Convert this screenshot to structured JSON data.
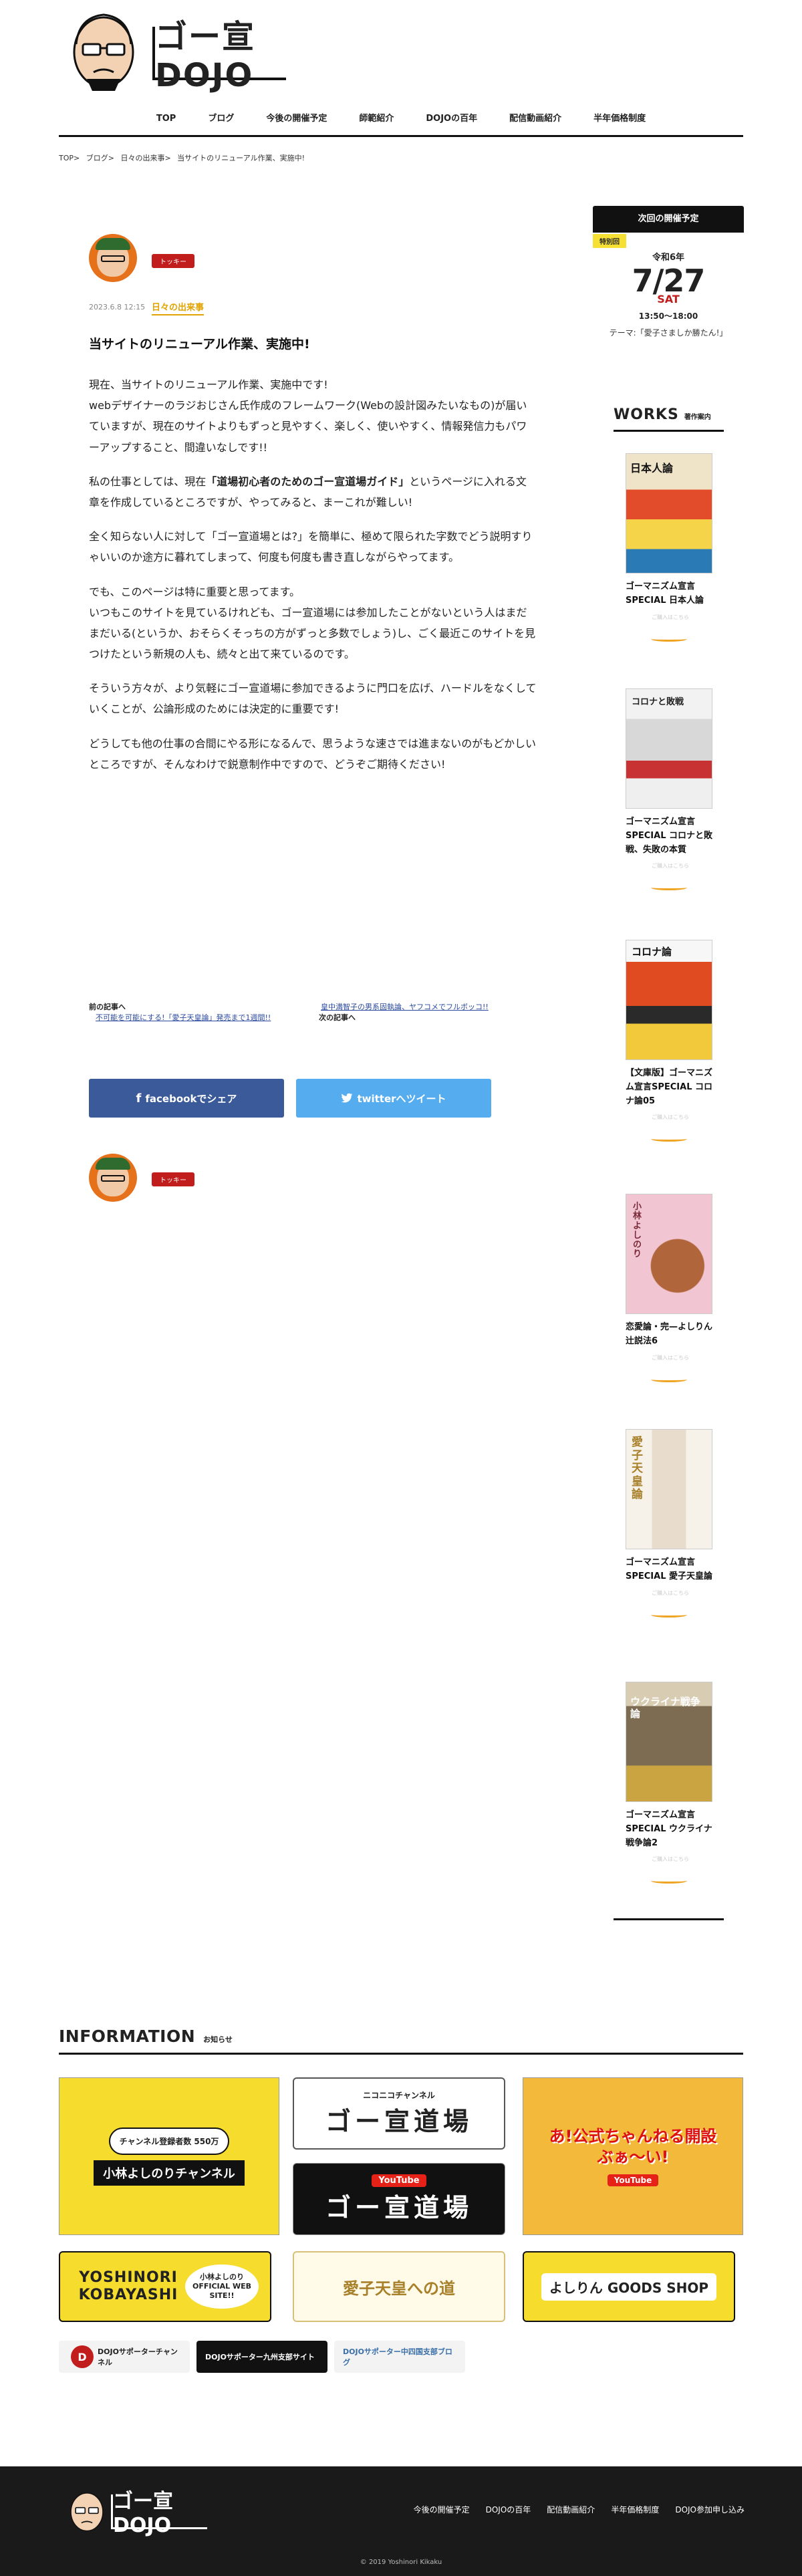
{
  "header": {
    "logo_text": "ゴー宣DOJO",
    "nav": [
      "TOP",
      "ブログ",
      "今後の開催予定",
      "師範紹介",
      "DOJOの百年",
      "配信動画紹介",
      "半年価格制度"
    ]
  },
  "breadcrumb": [
    "TOP",
    ">",
    "ブログ",
    ">",
    "日々の出来事",
    ">",
    "当サイトのリニューアル作業、実施中!"
  ],
  "post": {
    "author_tag": "トッキー",
    "date": "2023.6.8 12:15",
    "category": "日々の出来事",
    "title": "当サイトのリニューアル作業、実施中!",
    "p1": "現在、当サイトのリニューアル作業、実施中です!",
    "p1b": "webデザイナーのラジおじさん氏作成のフレームワーク(Webの設計図みたいなもの)が届いていますが、現在のサイトよりもずっと見やすく、楽しく、使いやすく、情報発信力もパワーアップすること、間違いなしです!!",
    "p2a": "私の仕事としては、現在",
    "p2b": "「道場初心者のためのゴー宣道場ガイド」",
    "p2c": "というページに入れる文章を作成しているところですが、やってみると、まーこれが難しい!",
    "p3": "全く知らない人に対して「ゴー宣道場とは?」を簡単に、極めて限られた字数でどう説明すりゃいいのか途方に暮れてしまって、何度も何度も書き直しながらやってます。",
    "p4": "でも、このページは特に重要と思ってます。",
    "p4b": "いつもこのサイトを見ているけれども、ゴー宣道場には参加したことがないという人はまだまだいる(というか、おそらくそっちの方がずっと多数でしょう)し、ごく最近このサイトを見つけたという新規の人も、続々と出て来ているのです。",
    "p5": "そういう方々が、より気軽にゴー宣道場に参加できるように門口を広げ、ハードルをなくしていくことが、公論形成のためには決定的に重要です!",
    "p6": "どうしても他の仕事の合間にやる形になるんで、思うような速さでは進まないのがもどかしいところですが、そんなわけで鋭意制作中ですので、どうぞご期待ください!"
  },
  "prevnext": {
    "prev_label": "前の記事へ",
    "prev_title": "不可能を可能にする!「愛子天皇論」発売まで1週間!!",
    "next_title": "皇中満智子の男系固執論、ヤフコメでフルボッコ!!",
    "next_label": "次の記事へ"
  },
  "share": {
    "facebook": "facebookでシェア",
    "twitter": "twitterへツイート"
  },
  "sidebar": {
    "next_event_head": "次回の開催予定",
    "special": "特別回",
    "year": "令和6年",
    "date": "7/27",
    "dow": "SAT",
    "time": "13:50〜18:00",
    "theme": "テーマ:「愛子さましか勝たん!」",
    "works_title": "WORKS",
    "works_sub": "著作案内",
    "amazon_small": "ご購入はこちら",
    "amazon_logo": "amazon",
    "books": [
      {
        "title": "ゴーマニズム宣言SPECIAL 日本人論",
        "cover_text": "日本人論",
        "cover_color": "#efe3c8"
      },
      {
        "title": "ゴーマニズム宣言SPECIAL コロナと敗戦、失敗の本質",
        "cover_text": "コロナと敗戦",
        "cover_color": "#e9e9e9"
      },
      {
        "title": "【文庫版】ゴーマニズム宣言SPECIAL コロナ論05",
        "cover_text": "コロナ論",
        "cover_color": "#f4f4f4"
      },
      {
        "title": "恋愛論・完—よしりん辻説法6",
        "cover_text": "小林よしのり",
        "cover_color": "#f1c6d2"
      },
      {
        "title": "ゴーマニズム宣言SPECIAL 愛子天皇論",
        "cover_text": "愛子天皇論",
        "cover_color": "#f6f2ea"
      },
      {
        "title": "ゴーマニズム宣言SPECIAL ウクライナ戦争論2",
        "cover_text": "ウクライナ戦争論",
        "cover_color": "#9a8a6d"
      }
    ]
  },
  "info": {
    "title": "INFORMATION",
    "sub": "お知らせ",
    "banners": [
      {
        "text": "小林よしのりチャンネル",
        "sub": "チャンネル登録者数 550万",
        "bg": "#f5dc2d"
      },
      {
        "text": "ゴー宣道場",
        "sub": "ニコニコチャンネル",
        "bg": "#ffffff"
      },
      {
        "text": "ゴー宣道場",
        "sub": "YouTube",
        "bg": "#111111"
      },
      {
        "text": "あ!公式ちゃんねる開設ぶぁ〜い!",
        "sub": "YouTube",
        "bg": "#f2b93a"
      },
      {
        "text": "YOSHINORI KOBAYASHI",
        "sub": "小林よしのり OFFICIAL WEB SITE!!",
        "bg": "#f5dc2d"
      },
      {
        "text": "愛子天皇への道",
        "sub": "",
        "bg": "#fffbe8"
      },
      {
        "text": "よしりん GOODS SHOP",
        "sub": "",
        "bg": "#f5dc2d"
      }
    ],
    "mini": [
      {
        "text": "DOJOサポーターチャンネル",
        "bg": "#f3f3f3"
      },
      {
        "text": "DOJOサポーター九州支部サイト",
        "bg": "#111111"
      },
      {
        "text": "DOJOサポーター中四国支部ブログ",
        "bg": "#f3f3f3"
      }
    ]
  },
  "footer": {
    "logo_text": "ゴー宣DOJO",
    "nav": [
      "今後の開催予定",
      "DOJOの百年",
      "配信動画紹介",
      "半年価格制度",
      "DOJO参加申し込み"
    ],
    "copyright": "© 2019 Yoshinori Kikaku"
  },
  "colors": {
    "accent_red": "#c21d1d",
    "accent_yellow": "#e0a300",
    "facebook": "#3b5a9a",
    "twitter": "#55acee",
    "footer_bg": "#1a1a1a"
  }
}
